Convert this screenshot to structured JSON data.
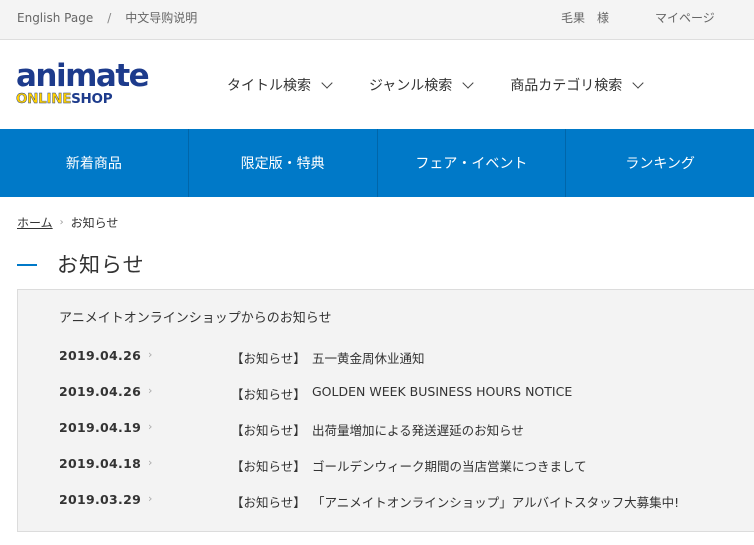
{
  "topbar": {
    "english": "English Page",
    "separator": "/",
    "chinese": "中文导购说明",
    "user": "毛果　様",
    "mypage": "マイページ"
  },
  "logo": {
    "line1": "animate",
    "online": "ONLINE",
    "shop": "SHOP"
  },
  "search_nav": [
    {
      "label": "タイトル検索"
    },
    {
      "label": "ジャンル検索"
    },
    {
      "label": "商品カテゴリ検索"
    }
  ],
  "menu": [
    {
      "label": "新着商品"
    },
    {
      "label": "限定版・特典"
    },
    {
      "label": "フェア・イベント"
    },
    {
      "label": "ランキング"
    }
  ],
  "breadcrumb": {
    "home": "ホーム",
    "arrow": "›",
    "current": "お知らせ"
  },
  "page_title": "お知らせ",
  "news": {
    "heading": "アニメイトオンラインショップからのお知らせ",
    "items": [
      {
        "date": "2019.04.26",
        "category": "【お知らせ】",
        "title": "五一黄金周休业通知"
      },
      {
        "date": "2019.04.26",
        "category": "【お知らせ】",
        "title": "GOLDEN WEEK BUSINESS HOURS NOTICE"
      },
      {
        "date": "2019.04.19",
        "category": "【お知らせ】",
        "title": "出荷量増加による発送遅延のお知らせ"
      },
      {
        "date": "2019.04.18",
        "category": "【お知らせ】",
        "title": "ゴールデンウィーク期間の当店営業につきまして"
      },
      {
        "date": "2019.03.29",
        "category": "【お知らせ】",
        "title": "「アニメイトオンラインショップ」アルバイトスタッフ大募集中!"
      }
    ],
    "row_arrow": "›"
  },
  "colors": {
    "accent_blue": "#0079c8",
    "logo_navy": "#1d3b8c",
    "logo_yellow": "#ffd000"
  }
}
